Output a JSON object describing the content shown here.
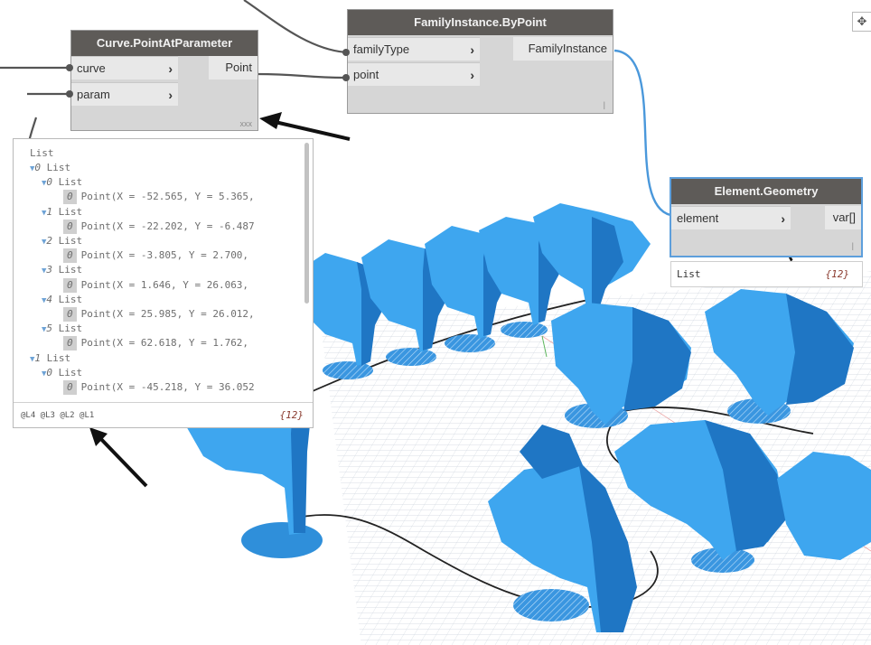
{
  "nodes": {
    "curve_point": {
      "title": "Curve.PointAtParameter",
      "inputs": [
        "curve",
        "param"
      ],
      "output": "Point",
      "lacing": "xxx"
    },
    "family_instance": {
      "title": "FamilyInstance.ByPoint",
      "inputs": [
        "familyType",
        "point"
      ],
      "output": "FamilyInstance",
      "lacing": "|"
    },
    "element_geometry": {
      "title": "Element.Geometry",
      "inputs": [
        "element"
      ],
      "output": "var[]",
      "lacing": "|"
    }
  },
  "preview": {
    "root": "List",
    "rows": [
      {
        "indent": 1,
        "toggle": true,
        "index": "0",
        "text": "List"
      },
      {
        "indent": 2,
        "toggle": true,
        "index": "0",
        "text": "List"
      },
      {
        "indent": 3,
        "toggle": false,
        "index": "0",
        "text": "Point(X = -52.565, Y = 5.365,"
      },
      {
        "indent": 2,
        "toggle": true,
        "index": "1",
        "text": "List"
      },
      {
        "indent": 3,
        "toggle": false,
        "index": "0",
        "text": "Point(X = -22.202, Y = -6.487"
      },
      {
        "indent": 2,
        "toggle": true,
        "index": "2",
        "text": "List"
      },
      {
        "indent": 3,
        "toggle": false,
        "index": "0",
        "text": "Point(X = -3.805, Y = 2.700,"
      },
      {
        "indent": 2,
        "toggle": true,
        "index": "3",
        "text": "List"
      },
      {
        "indent": 3,
        "toggle": false,
        "index": "0",
        "text": "Point(X = 1.646, Y = 26.063,"
      },
      {
        "indent": 2,
        "toggle": true,
        "index": "4",
        "text": "List"
      },
      {
        "indent": 3,
        "toggle": false,
        "index": "0",
        "text": "Point(X = 25.985, Y = 26.012,"
      },
      {
        "indent": 2,
        "toggle": true,
        "index": "5",
        "text": "List"
      },
      {
        "indent": 3,
        "toggle": false,
        "index": "0",
        "text": "Point(X = 62.618, Y = 1.762,"
      },
      {
        "indent": 1,
        "toggle": true,
        "index": "1",
        "text": "List"
      },
      {
        "indent": 2,
        "toggle": true,
        "index": "0",
        "text": "List"
      },
      {
        "indent": 3,
        "toggle": false,
        "index": "0",
        "text": "Point(X = -45.218, Y = 36.052"
      }
    ],
    "levels": "@L4 @L3 @L2 @L1",
    "count": "{12}"
  },
  "list_preview": {
    "label": "List",
    "count": "{12}"
  },
  "colors": {
    "light_blue": "#3ea6ef",
    "dark_blue": "#1f76c4",
    "node_title_bg": "#5e5b58",
    "wire_selected": "#4a98db"
  },
  "icons": [
    "pan-icon",
    "arrow-icon",
    "cursor-icon"
  ]
}
